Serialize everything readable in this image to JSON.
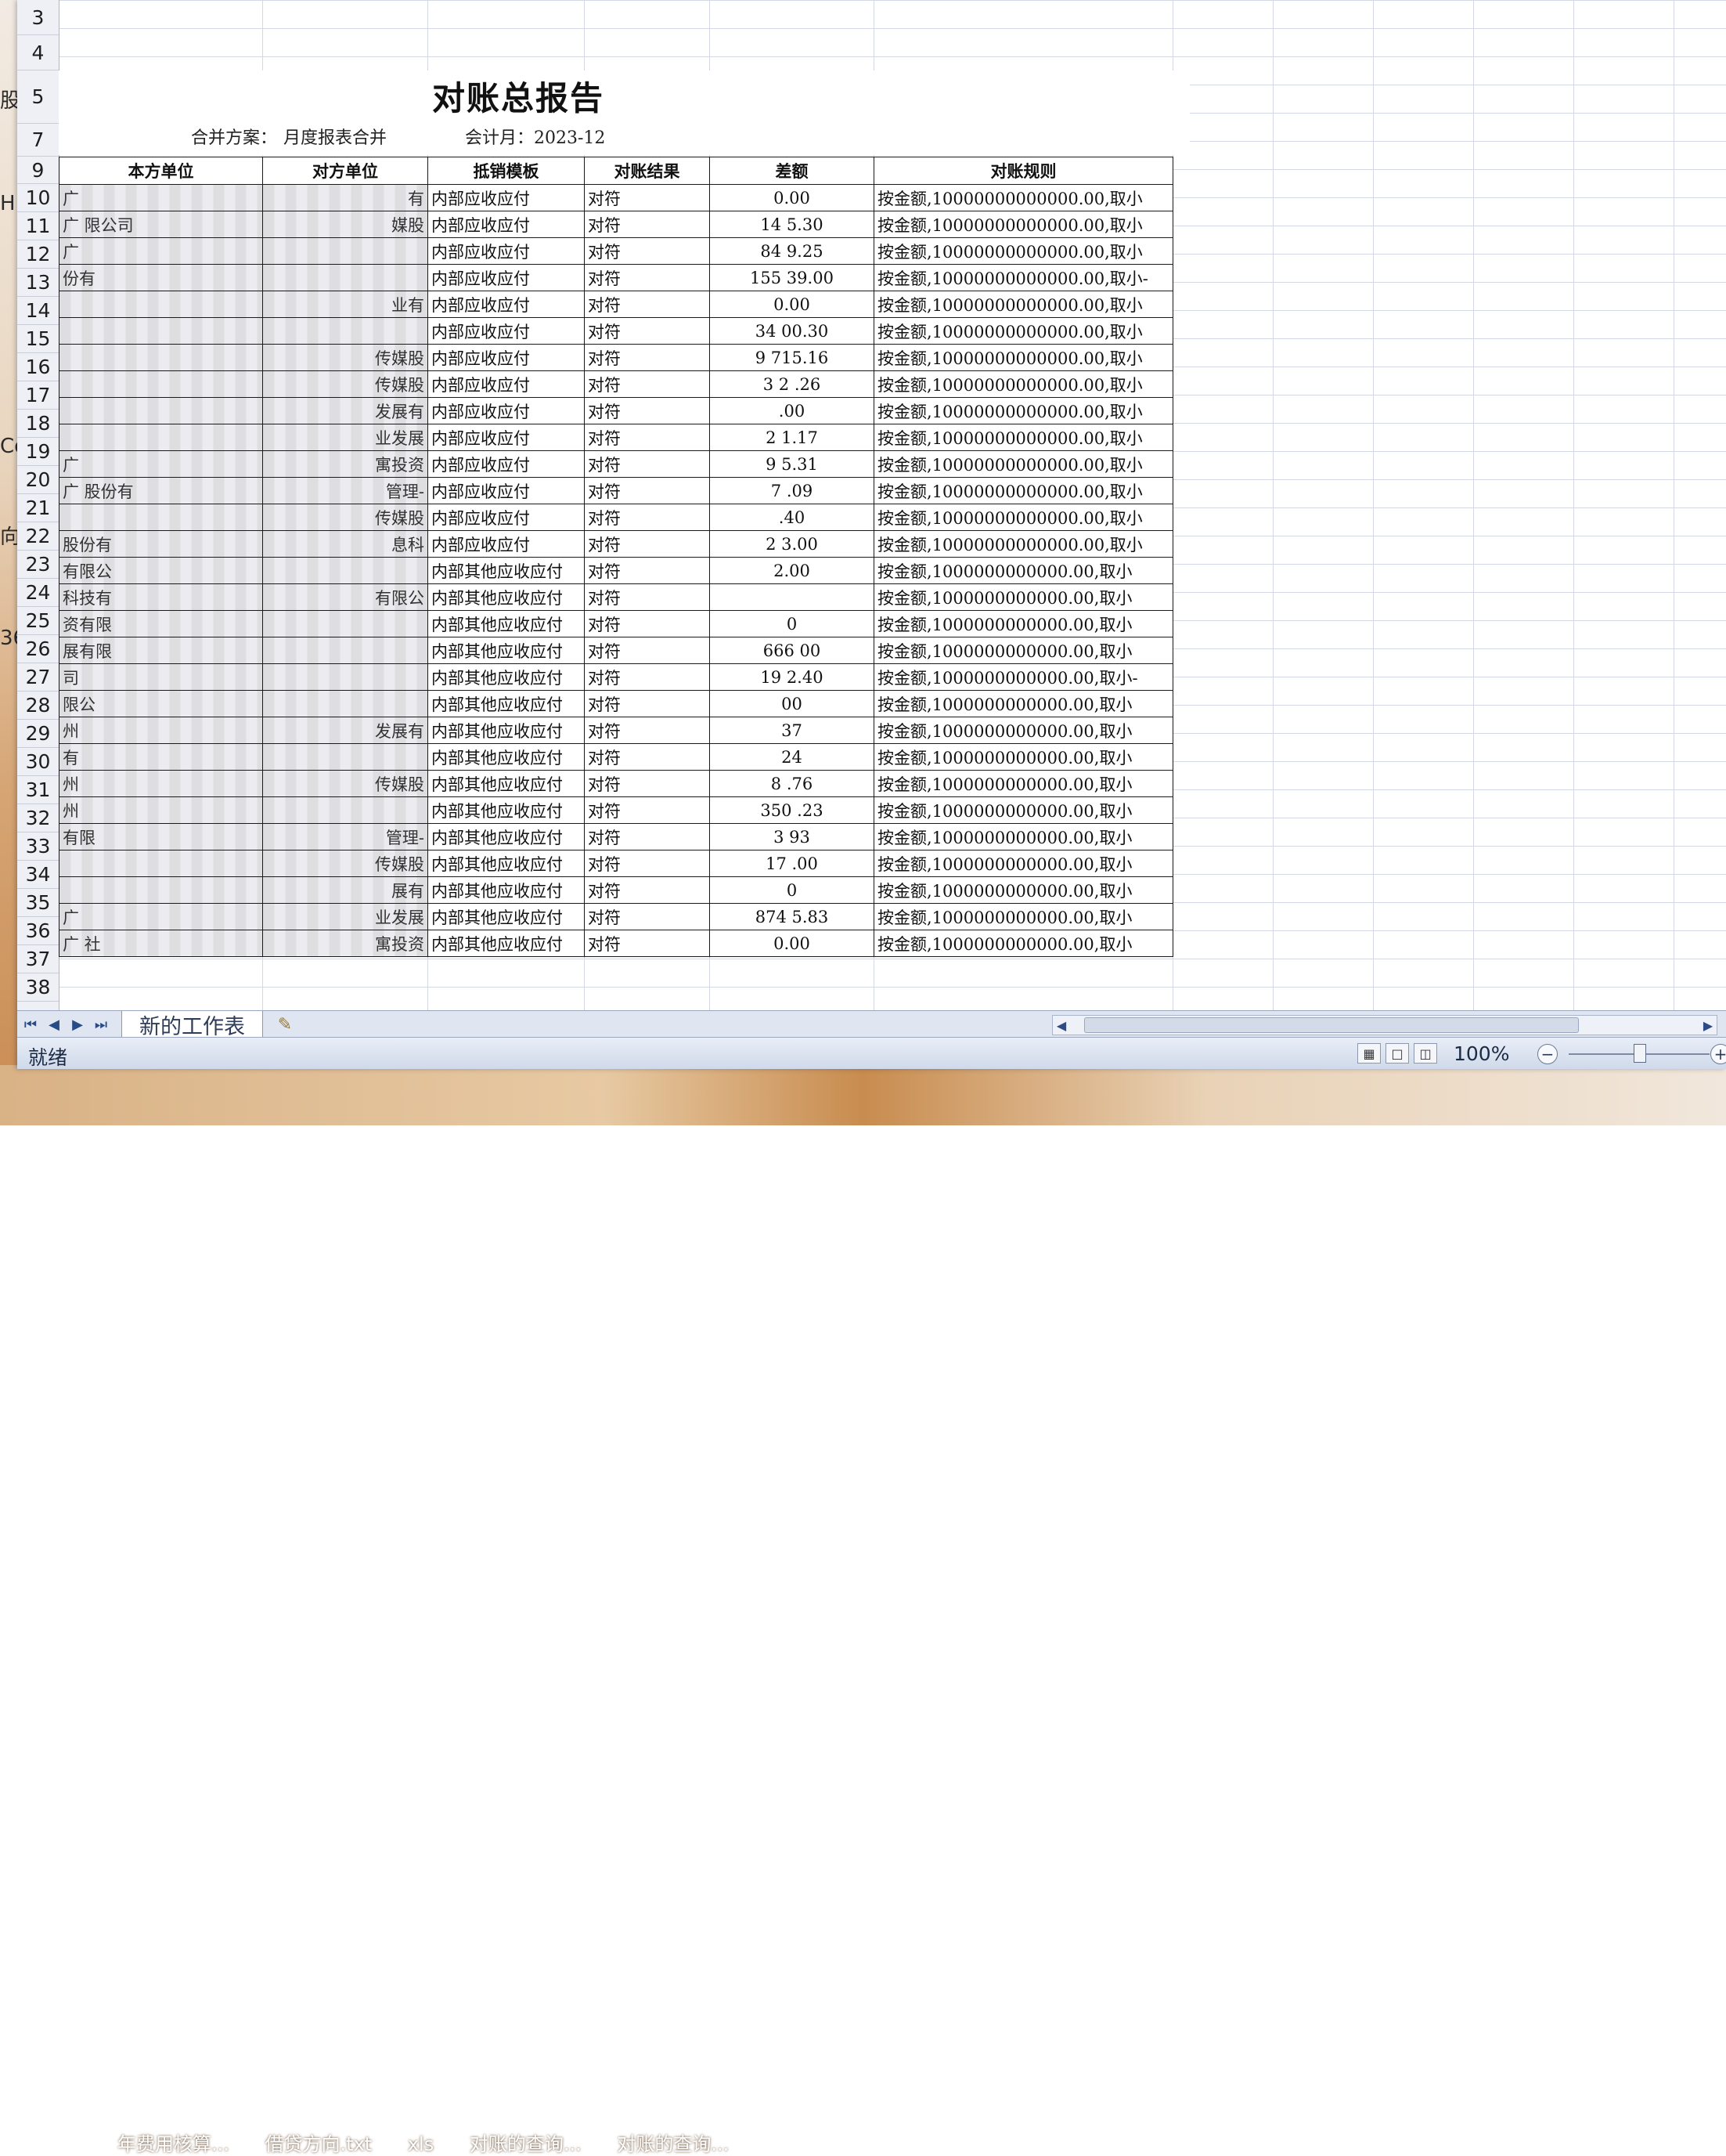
{
  "desktop": {
    "side_fragments": [
      "股",
      "H",
      "Co",
      "向",
      "36"
    ],
    "taskbar_labels": [
      "年费用核算...",
      "借贷方向.txt",
      "xls",
      "对账的查询...",
      "对账的查询..."
    ]
  },
  "sheet": {
    "row_numbers": [
      "3",
      "4",
      "5",
      "7",
      "9",
      "10",
      "11",
      "12",
      "13",
      "14",
      "15",
      "16",
      "17",
      "18",
      "19",
      "20",
      "21",
      "22",
      "23",
      "24",
      "25",
      "26",
      "27",
      "28",
      "29",
      "30",
      "31",
      "32",
      "33",
      "34",
      "35",
      "36",
      "37",
      "38"
    ],
    "report": {
      "title": "对账总报告",
      "plan_label": "合并方案：",
      "plan_value": "月度报表合并",
      "period_label": "会计月：2023-12",
      "headers": [
        "本方单位",
        "对方单位",
        "抵销模板",
        "对账结果",
        "差额",
        "对账规则"
      ],
      "rows": [
        {
          "own": "广",
          "counter": "有",
          "template": "内部应收应付",
          "result": "对符",
          "diff": "0.00",
          "rule": "按金额,10000000000000.00,取小"
        },
        {
          "own": "广 限公司",
          "counter": "媒股",
          "template": "内部应收应付",
          "result": "对符",
          "diff": "14 5.30",
          "rule": "按金额,10000000000000.00,取小"
        },
        {
          "own": "广",
          "counter": "",
          "template": "内部应收应付",
          "result": "对符",
          "diff": "84 9.25",
          "rule": "按金额,10000000000000.00,取小"
        },
        {
          "own": "份有",
          "counter": "",
          "template": "内部应收应付",
          "result": "对符",
          "diff": "155 39.00",
          "rule": "按金额,10000000000000.00,取小-"
        },
        {
          "own": "",
          "counter": "业有",
          "template": "内部应收应付",
          "result": "对符",
          "diff": "0.00",
          "rule": "按金额,10000000000000.00,取小"
        },
        {
          "own": "",
          "counter": "",
          "template": "内部应收应付",
          "result": "对符",
          "diff": "34 00.30",
          "rule": "按金额,10000000000000.00,取小"
        },
        {
          "own": "",
          "counter": "传媒股",
          "template": "内部应收应付",
          "result": "对符",
          "diff": "9 715.16",
          "rule": "按金额,10000000000000.00,取小"
        },
        {
          "own": "",
          "counter": "传媒股",
          "template": "内部应收应付",
          "result": "对符",
          "diff": "3 2 .26",
          "rule": "按金额,10000000000000.00,取小"
        },
        {
          "own": "",
          "counter": "发展有",
          "template": "内部应收应付",
          "result": "对符",
          "diff": ".00",
          "rule": "按金额,10000000000000.00,取小"
        },
        {
          "own": "",
          "counter": "业发展",
          "template": "内部应收应付",
          "result": "对符",
          "diff": "2 1.17",
          "rule": "按金额,10000000000000.00,取小"
        },
        {
          "own": "广",
          "counter": "寓投资",
          "template": "内部应收应付",
          "result": "对符",
          "diff": "9 5.31",
          "rule": "按金额,10000000000000.00,取小"
        },
        {
          "own": "广 股份有",
          "counter": "管理-",
          "template": "内部应收应付",
          "result": "对符",
          "diff": "7 .09",
          "rule": "按金额,10000000000000.00,取小"
        },
        {
          "own": "",
          "counter": "传媒股",
          "template": "内部应收应付",
          "result": "对符",
          "diff": ".40",
          "rule": "按金额,10000000000000.00,取小"
        },
        {
          "own": "股份有",
          "counter": "息科",
          "template": "内部应收应付",
          "result": "对符",
          "diff": "2 3.00",
          "rule": "按金额,10000000000000.00,取小"
        },
        {
          "own": "有限公",
          "counter": "",
          "template": "内部其他应收应付",
          "result": "对符",
          "diff": "2.00",
          "rule": "按金额,1000000000000.00,取小"
        },
        {
          "own": "科技有",
          "counter": "有限公",
          "template": "内部其他应收应付",
          "result": "对符",
          "diff": "",
          "rule": "按金额,1000000000000.00,取小"
        },
        {
          "own": "资有限",
          "counter": "",
          "template": "内部其他应收应付",
          "result": "对符",
          "diff": "0",
          "rule": "按金额,1000000000000.00,取小"
        },
        {
          "own": "展有限",
          "counter": "",
          "template": "内部其他应收应付",
          "result": "对符",
          "diff": "666 00",
          "rule": "按金额,1000000000000.00,取小"
        },
        {
          "own": "司",
          "counter": "",
          "template": "内部其他应收应付",
          "result": "对符",
          "diff": "19 2.40",
          "rule": "按金额,1000000000000.00,取小-"
        },
        {
          "own": "限公",
          "counter": "",
          "template": "内部其他应收应付",
          "result": "对符",
          "diff": "00",
          "rule": "按金额,1000000000000.00,取小"
        },
        {
          "own": "州",
          "counter": "发展有",
          "template": "内部其他应收应付",
          "result": "对符",
          "diff": "37",
          "rule": "按金额,1000000000000.00,取小"
        },
        {
          "own": "有",
          "counter": "",
          "template": "内部其他应收应付",
          "result": "对符",
          "diff": "24",
          "rule": "按金额,1000000000000.00,取小"
        },
        {
          "own": "州",
          "counter": "传媒股",
          "template": "内部其他应收应付",
          "result": "对符",
          "diff": "8 .76",
          "rule": "按金额,1000000000000.00,取小"
        },
        {
          "own": "州",
          "counter": "",
          "template": "内部其他应收应付",
          "result": "对符",
          "diff": "350 .23",
          "rule": "按金额,1000000000000.00,取小"
        },
        {
          "own": "有限",
          "counter": "管理-",
          "template": "内部其他应收应付",
          "result": "对符",
          "diff": "3 93",
          "rule": "按金额,1000000000000.00,取小"
        },
        {
          "own": "",
          "counter": "传媒股",
          "template": "内部其他应收应付",
          "result": "对符",
          "diff": "17 .00",
          "rule": "按金额,1000000000000.00,取小"
        },
        {
          "own": "",
          "counter": "展有",
          "template": "内部其他应收应付",
          "result": "对符",
          "diff": "0",
          "rule": "按金额,1000000000000.00,取小"
        },
        {
          "own": "广",
          "counter": "业发展",
          "template": "内部其他应收应付",
          "result": "对符",
          "diff": "874 5.83",
          "rule": "按金额,1000000000000.00,取小"
        },
        {
          "own": "广 社",
          "counter": "寓投资",
          "template": "内部其他应收应付",
          "result": "对符",
          "diff": "0.00",
          "rule": "按金额,1000000000000.00,取小"
        }
      ]
    }
  },
  "tabs": {
    "sheet_name": "新的工作表",
    "nav": [
      "⏮",
      "◀",
      "▶",
      "⏭"
    ]
  },
  "status": {
    "ready": "就绪",
    "zoom": "100%",
    "zoom_minus": "−",
    "zoom_plus": "+",
    "zoom_fraction": 0.5
  },
  "colors": {
    "grid": "#d4d8e4",
    "header_bg": "#eef0f6",
    "statusbar": "#cfd9ea",
    "tabbar": "#dfe6f2"
  }
}
